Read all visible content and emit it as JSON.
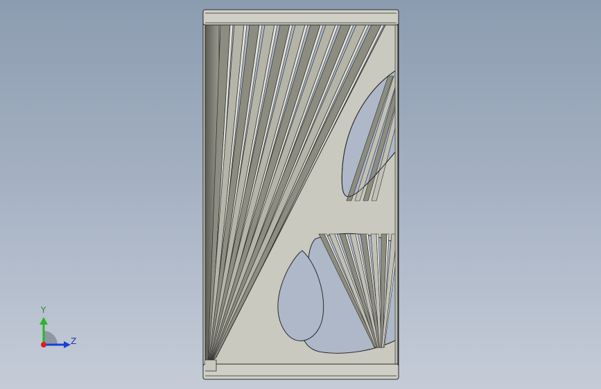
{
  "viewport": {
    "background_top": "#8c9cb0",
    "background_bottom": "#c5ccd8"
  },
  "model": {
    "face_color": "#c9c9bf",
    "slat_dark": "#8a8a7c",
    "slat_light": "#d8d8d0",
    "edge_color": "#2a2a2a",
    "opening_color": "#aeb8c8"
  },
  "triad": {
    "y_label": "Y",
    "z_label": "Z",
    "y_color": "#2bb52b",
    "z_color": "#1a3fd6",
    "x_color": "#d42020"
  }
}
